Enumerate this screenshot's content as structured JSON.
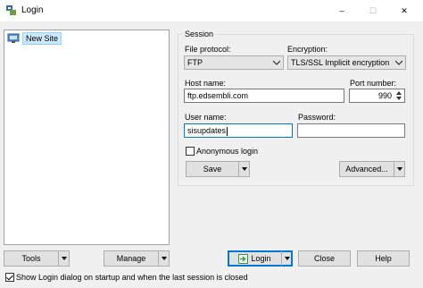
{
  "window": {
    "title": "Login",
    "controls": {
      "minimize": "–",
      "maximize": "☐",
      "close": "✕"
    }
  },
  "site_tree": {
    "items": [
      {
        "label": "New Site",
        "icon": "computer-icon",
        "selected": true
      }
    ]
  },
  "session": {
    "group_label": "Session",
    "file_protocol": {
      "label": "File protocol:",
      "value": "FTP"
    },
    "encryption": {
      "label": "Encryption:",
      "value": "TLS/SSL Implicit encryption"
    },
    "host_name": {
      "label": "Host name:",
      "value": "ftp.edsembli.com"
    },
    "port_number": {
      "label": "Port number:",
      "value": "990"
    },
    "user_name": {
      "label": "User name:",
      "value": "sisupdates"
    },
    "password": {
      "label": "Password:",
      "value": ""
    },
    "anonymous_login": {
      "label": "Anonymous login",
      "checked": false
    },
    "save_label": "Save",
    "advanced_label": "Advanced..."
  },
  "footer": {
    "tools_label": "Tools",
    "manage_label": "Manage",
    "login_label": "Login",
    "close_label": "Close",
    "help_label": "Help",
    "show_login_dialog": {
      "label": "Show Login dialog on startup and when the last session is closed",
      "checked": true
    }
  },
  "colors": {
    "accent": "#0078d7",
    "selection": "#cce8ff",
    "login_icon": "#2e9d3a"
  }
}
